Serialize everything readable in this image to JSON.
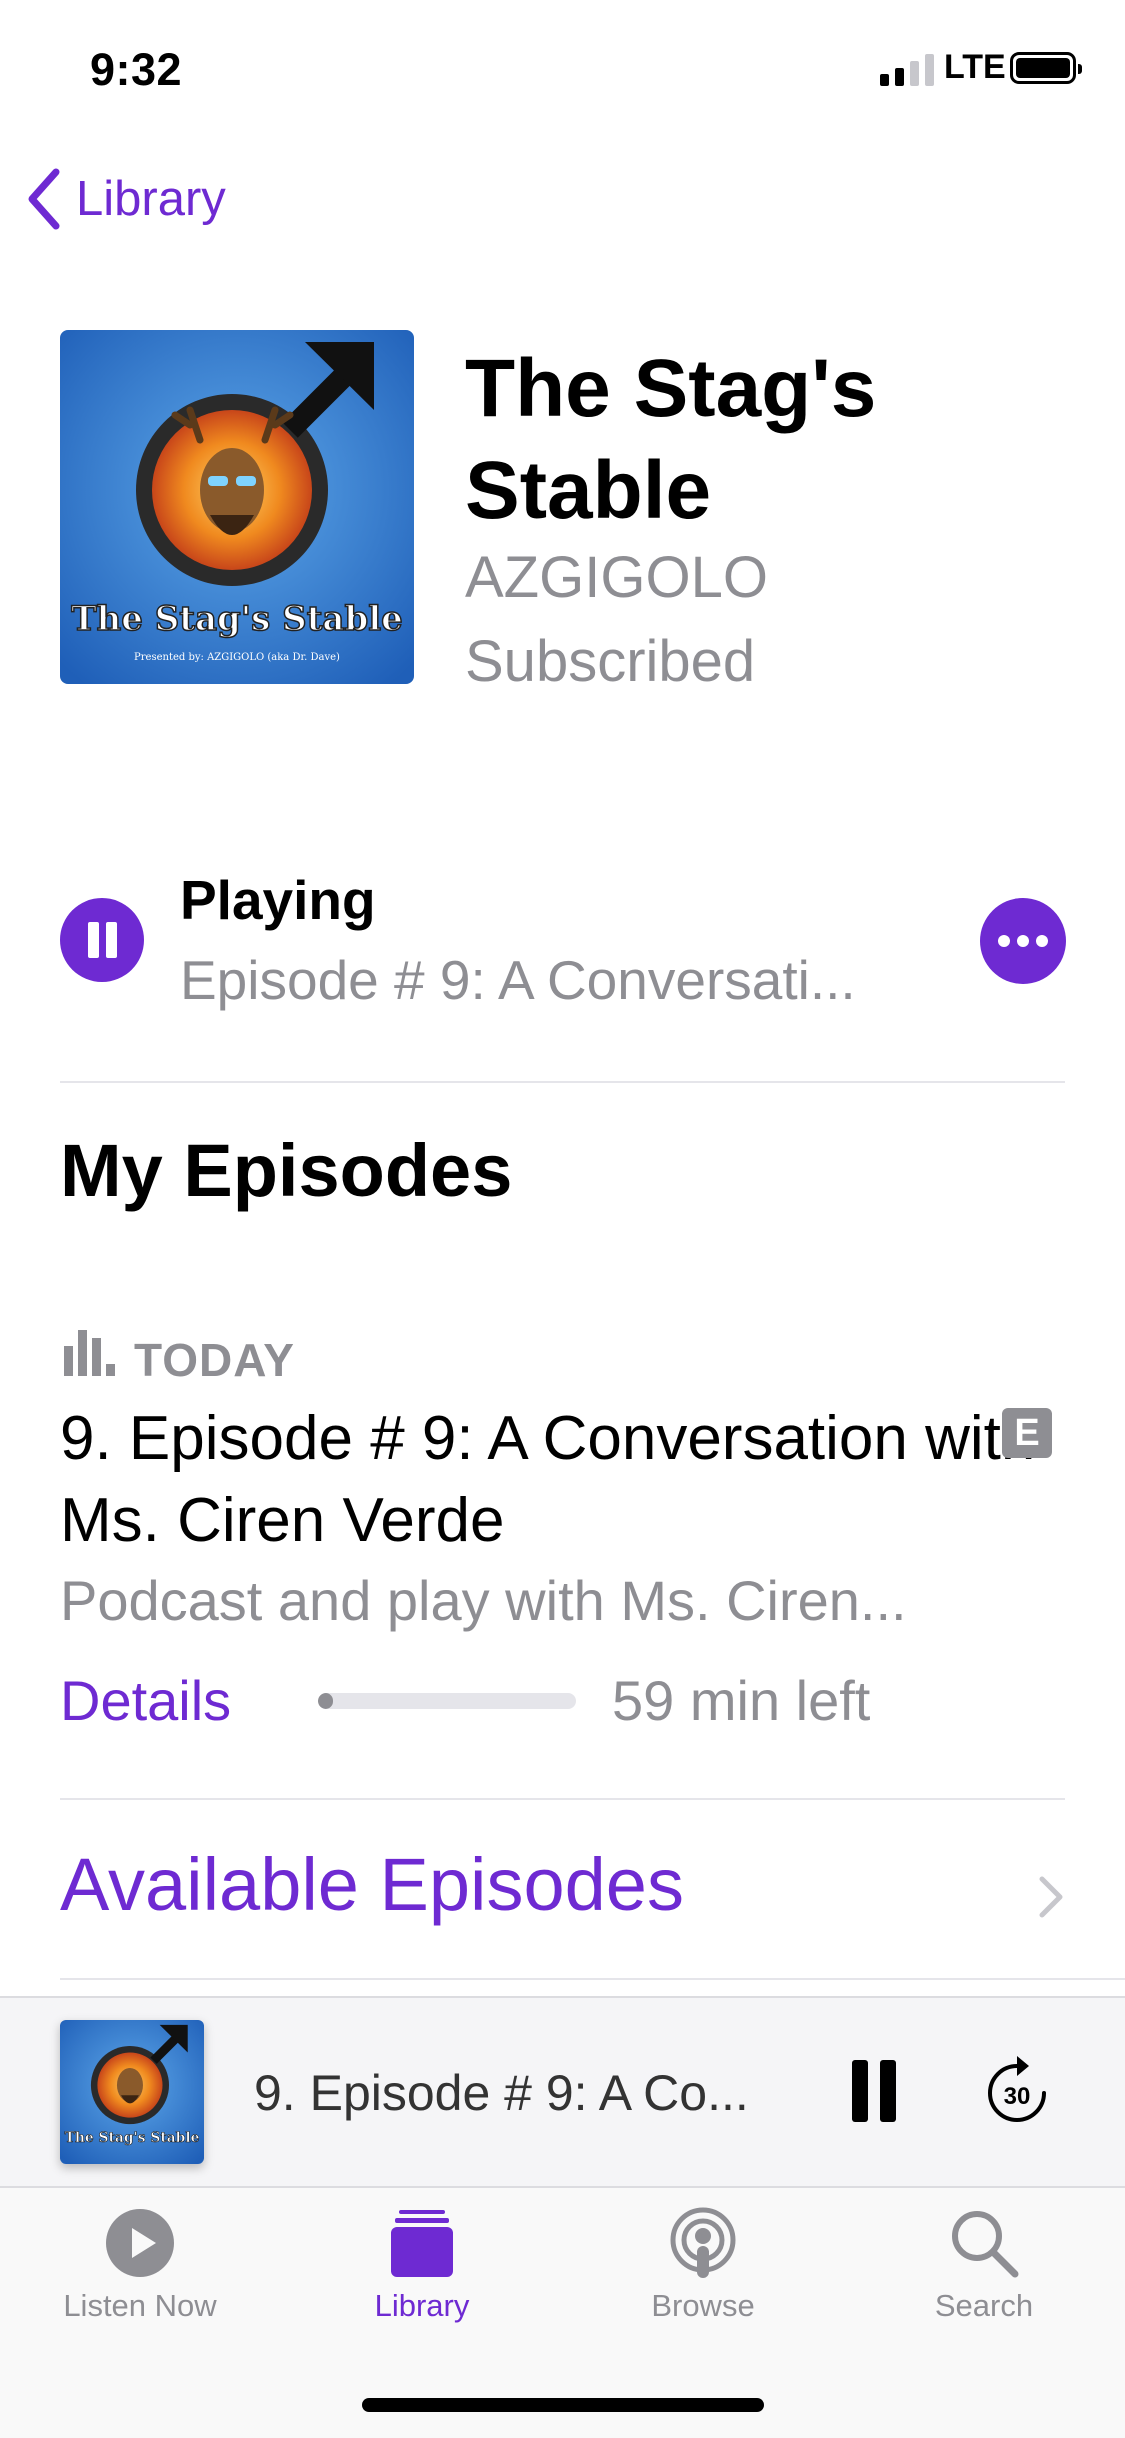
{
  "status_bar": {
    "time": "9:32",
    "network": "LTE"
  },
  "nav": {
    "back_label": "Library"
  },
  "podcast": {
    "title": "The Stag's Stable",
    "author": "AZGIGOLO",
    "subscription": "Subscribed",
    "artwork_title": "The Stag's Stable",
    "artwork_subtitle": "Presented by: AZGIGOLO (aka Dr. Dave)"
  },
  "now_playing": {
    "label": "Playing",
    "episode": "Episode # 9: A Conversati..."
  },
  "my_episodes": {
    "heading": "My Episodes",
    "episodes": [
      {
        "date": "TODAY",
        "title": "9. Episode # 9: A Conversation with Ms. Ciren Verde",
        "explicit": "E",
        "description": "Podcast and play with Ms. Ciren...",
        "details_label": "Details",
        "progress": 0.05,
        "time_left": "59 min left"
      }
    ]
  },
  "available_episodes_label": "Available Episodes",
  "mini_player": {
    "title": "9. Episode # 9: A Co...",
    "skip_seconds": "30"
  },
  "tabs": [
    {
      "label": "Listen Now",
      "icon": "play-circle-icon",
      "active": false
    },
    {
      "label": "Library",
      "icon": "library-icon",
      "active": true
    },
    {
      "label": "Browse",
      "icon": "podcast-icon",
      "active": false
    },
    {
      "label": "Search",
      "icon": "search-icon",
      "active": false
    }
  ],
  "colors": {
    "accent": "#6e2ad2",
    "secondary_text": "#8e8e93"
  }
}
